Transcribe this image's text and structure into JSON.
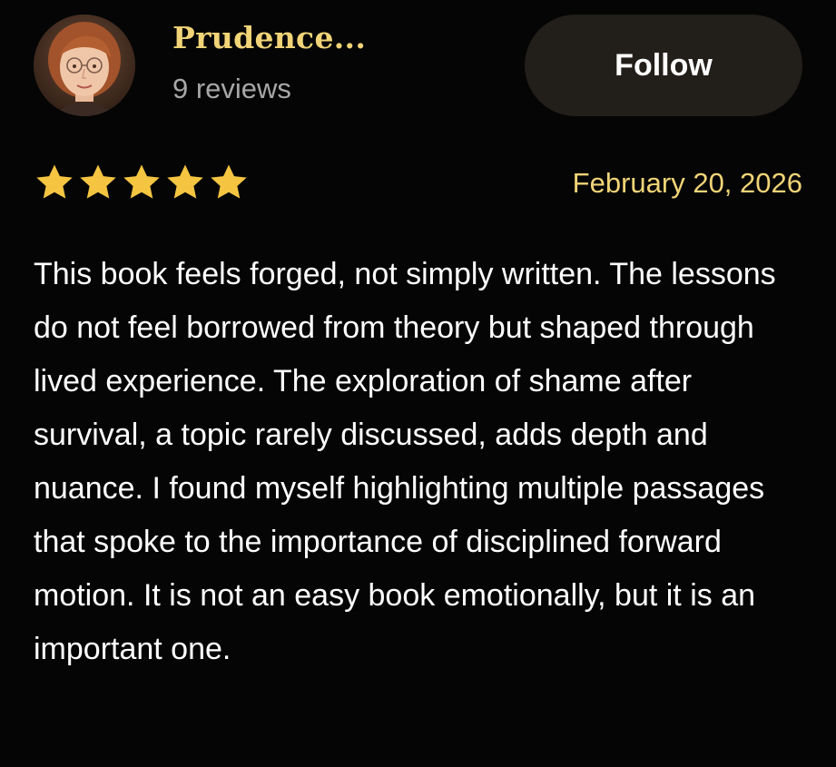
{
  "reviewer": {
    "name": "Prudence...",
    "review_count": "9 reviews",
    "avatar_icon": "user-avatar-photo"
  },
  "follow_button": {
    "label": "Follow"
  },
  "rating": {
    "stars": 5,
    "max": 5,
    "icon": "star-icon",
    "color": "#f5c542"
  },
  "review": {
    "date": "February 20, 2026",
    "text": "This book feels forged, not simply written. The lessons do not feel borrowed from theory but shaped through lived experience. The exploration of shame after survival, a topic rarely discussed, adds depth and nuance. I found myself highlighting multiple passages that spoke to the importance of disciplined forward motion. It is not an easy book emotionally, but it is an important one."
  },
  "colors": {
    "background": "#050505",
    "accent": "#f1d477",
    "muted_text": "#a7a7a7",
    "button_bg": "#221e1a"
  }
}
